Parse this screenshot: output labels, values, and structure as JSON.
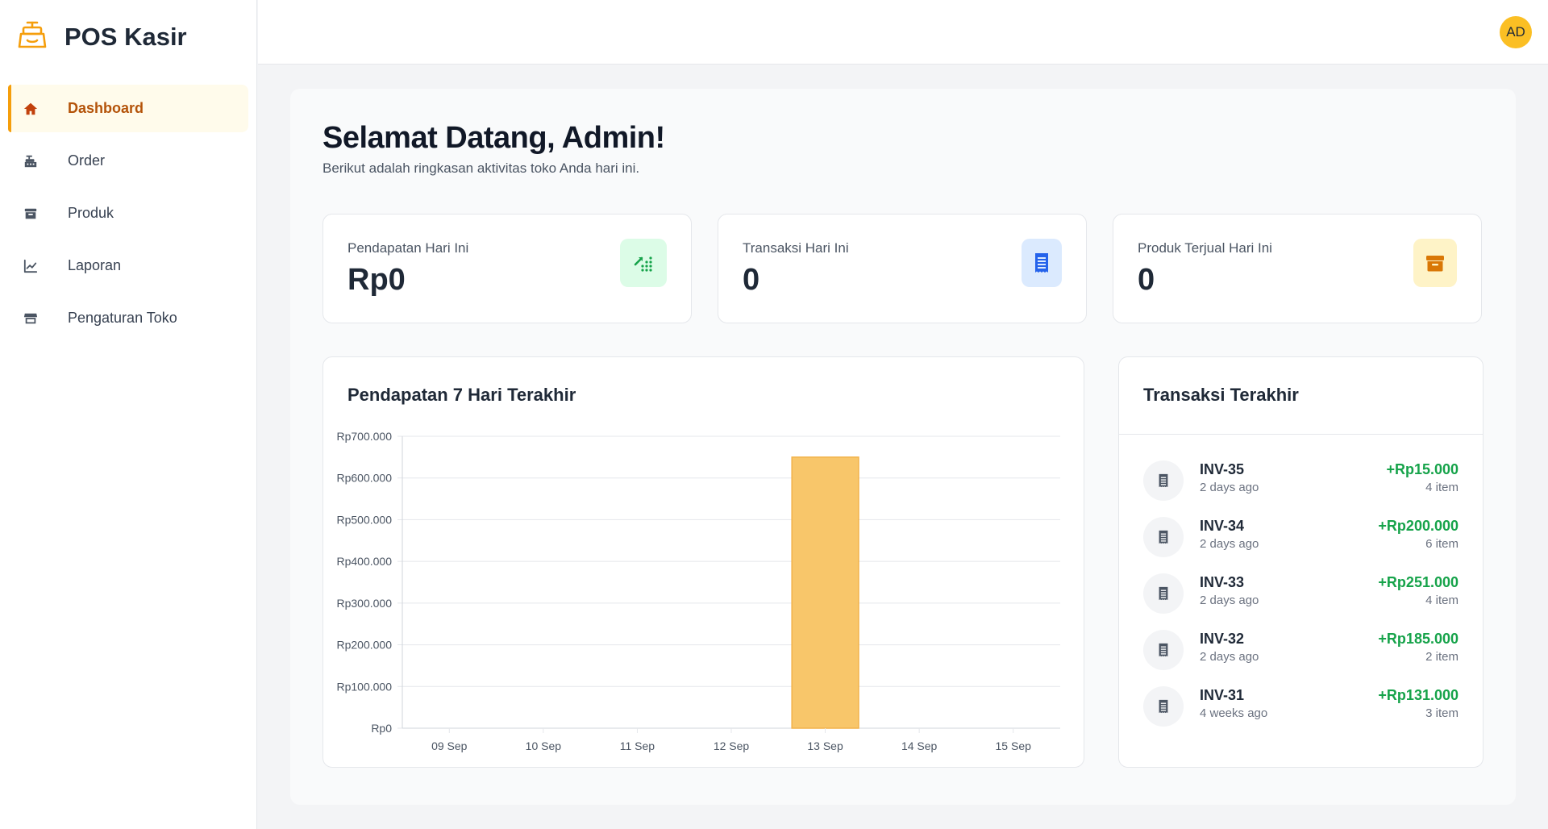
{
  "app": {
    "name": "POS Kasir",
    "logo_icon": "cash-register-icon"
  },
  "sidebar": {
    "items": [
      {
        "label": "Dashboard",
        "icon": "home-icon",
        "active": true
      },
      {
        "label": "Order",
        "icon": "cash-register-icon",
        "active": false
      },
      {
        "label": "Produk",
        "icon": "archive-icon",
        "active": false
      },
      {
        "label": "Laporan",
        "icon": "line-chart-icon",
        "active": false
      },
      {
        "label": "Pengaturan Toko",
        "icon": "store-icon",
        "active": false
      }
    ]
  },
  "header": {
    "avatar_initials": "AD"
  },
  "welcome": {
    "title": "Selamat Datang, Admin!",
    "subtitle": "Berikut adalah ringkasan aktivitas toko Anda hari ini."
  },
  "stats": [
    {
      "label": "Pendapatan Hari Ini",
      "value": "Rp0",
      "icon": "trend-up-icon",
      "icon_color": "#16a34a",
      "badge_bg": "#dcfce7"
    },
    {
      "label": "Transaksi Hari Ini",
      "value": "0",
      "icon": "receipt-icon",
      "icon_color": "#2563eb",
      "badge_bg": "#dbeafe"
    },
    {
      "label": "Produk Terjual Hari Ini",
      "value": "0",
      "icon": "box-icon",
      "icon_color": "#d97706",
      "badge_bg": "#fef3c7"
    }
  ],
  "revenue_chart": {
    "title": "Pendapatan 7 Hari Terakhir"
  },
  "chart_data": {
    "type": "bar",
    "categories": [
      "09 Sep",
      "10 Sep",
      "11 Sep",
      "12 Sep",
      "13 Sep",
      "14 Sep",
      "15 Sep"
    ],
    "values": [
      0,
      0,
      0,
      0,
      650000,
      0,
      0
    ],
    "title": "Pendapatan 7 Hari Terakhir",
    "xlabel": "",
    "ylabel": "",
    "ylim": [
      0,
      700000
    ],
    "yticks": [
      0,
      100000,
      200000,
      300000,
      400000,
      500000,
      600000,
      700000
    ],
    "ytick_labels": [
      "Rp0",
      "Rp100.000",
      "Rp200.000",
      "Rp300.000",
      "Rp400.000",
      "Rp500.000",
      "Rp600.000",
      "Rp700.000"
    ],
    "grid": true,
    "bar_color": "#f8c66a"
  },
  "transactions": {
    "title": "Transaksi Terakhir",
    "items": [
      {
        "invoice": "INV-35",
        "time": "2 days ago",
        "amount": "+Rp15.000",
        "items": "4 item"
      },
      {
        "invoice": "INV-34",
        "time": "2 days ago",
        "amount": "+Rp200.000",
        "items": "6 item"
      },
      {
        "invoice": "INV-33",
        "time": "2 days ago",
        "amount": "+Rp251.000",
        "items": "4 item"
      },
      {
        "invoice": "INV-32",
        "time": "2 days ago",
        "amount": "+Rp185.000",
        "items": "2 item"
      },
      {
        "invoice": "INV-31",
        "time": "4 weeks ago",
        "amount": "+Rp131.000",
        "items": "3 item"
      }
    ]
  }
}
